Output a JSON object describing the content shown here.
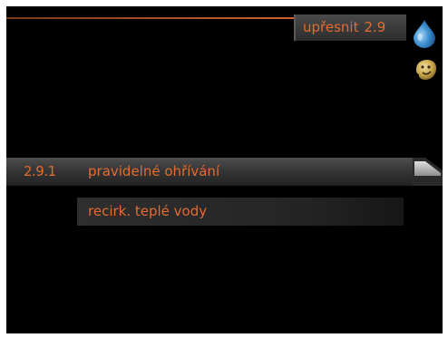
{
  "header": {
    "title": "upřesnit",
    "menu_number": "2.9"
  },
  "icons": {
    "status_icon": "water-drop-icon",
    "user_icon": "smiley-face-icon"
  },
  "menu": {
    "items": [
      {
        "number": "2.9.1",
        "label": "pravidelné ohřívání",
        "selected": true
      },
      {
        "number": "",
        "label": "recirk. teplé vody",
        "selected": false
      }
    ]
  },
  "colors": {
    "accent": "#e36b2f",
    "background": "#000000",
    "drop": "#3d8fd1"
  }
}
